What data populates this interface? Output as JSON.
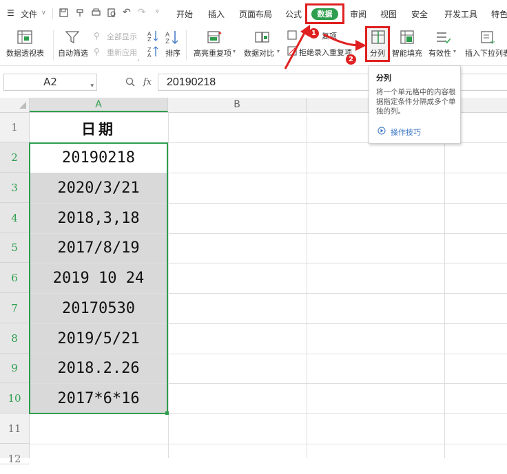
{
  "menu": {
    "file": "文件",
    "tabs": [
      "开始",
      "插入",
      "页面布局",
      "公式",
      "数据",
      "审阅",
      "视图",
      "安全",
      "开发工具",
      "特色"
    ]
  },
  "ribbon": {
    "pivot": "数据透视表",
    "autofilter": "自动筛选",
    "show_all": "全部显示",
    "reapply": "重新应用",
    "sort": "排序",
    "highlight_dup": "高亮重复项",
    "compare": "数据对比",
    "dup_item": "复项",
    "reject_dup": "拒绝录入重复项",
    "split": "分列",
    "smart_fill": "智能填充",
    "validity": "有效性",
    "dropdown": "插入下拉列表"
  },
  "formula_bar": {
    "name_box": "A2",
    "fx": "fx",
    "value": "20190218"
  },
  "grid": {
    "columns": [
      "A",
      "B"
    ],
    "rows": [
      "1",
      "2",
      "3",
      "4",
      "5",
      "6",
      "7",
      "8",
      "9",
      "10",
      "11",
      "12"
    ],
    "header_cell": "日期",
    "cells": [
      "20190218",
      "2020/3/21",
      "2018,3,18",
      "2017/8/19",
      "2019 10 24",
      "20170530",
      "2019/5/21",
      "2018.2.26",
      "2017*6*16"
    ]
  },
  "tooltip": {
    "title": "分列",
    "description": "将一个单元格中的内容根据指定条件分隔成多个单独的列。",
    "link": "操作技巧"
  },
  "annotations": {
    "step1": "1",
    "step2": "2"
  },
  "colors": {
    "accent_green": "#2e9e4e",
    "highlight_red": "#e02020",
    "selected_fill": "#d9d9d9"
  }
}
